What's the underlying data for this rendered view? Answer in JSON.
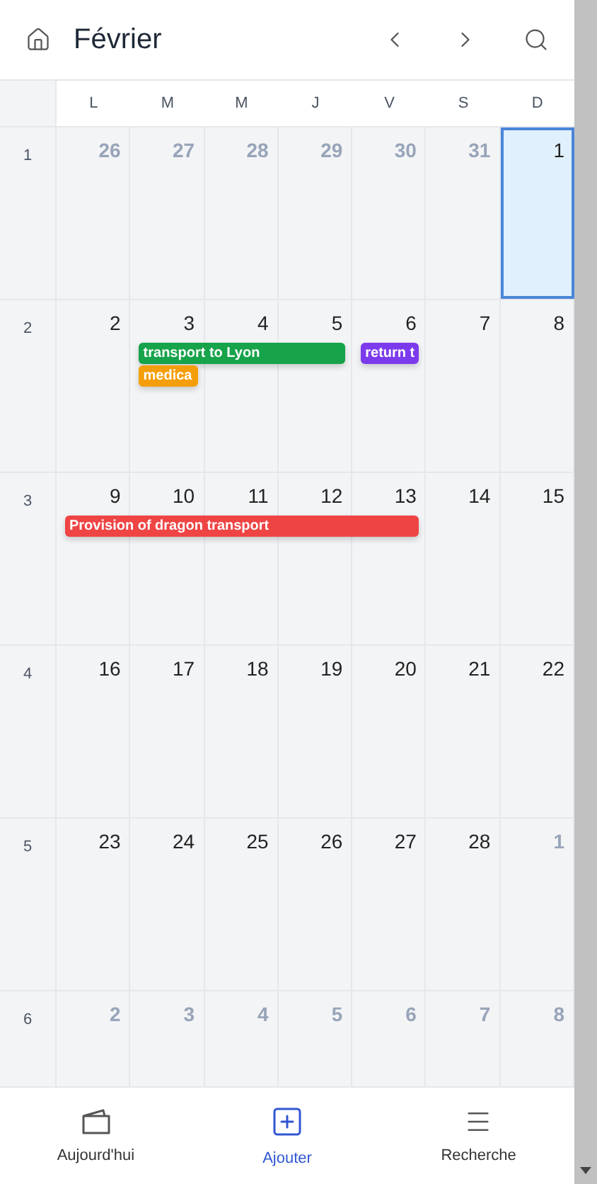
{
  "header": {
    "title": "Février"
  },
  "weekdays": [
    "L",
    "M",
    "M",
    "J",
    "V",
    "S",
    "D"
  ],
  "weeks": [
    {
      "number": "1",
      "days": [
        {
          "day": "26",
          "other_month": true,
          "today": false
        },
        {
          "day": "27",
          "other_month": true,
          "today": false
        },
        {
          "day": "28",
          "other_month": true,
          "today": false
        },
        {
          "day": "29",
          "other_month": true,
          "today": false
        },
        {
          "day": "30",
          "other_month": true,
          "today": false
        },
        {
          "day": "31",
          "other_month": true,
          "today": false
        },
        {
          "day": "1",
          "other_month": false,
          "today": true
        }
      ]
    },
    {
      "number": "2",
      "days": [
        {
          "day": "2",
          "other_month": false,
          "today": false
        },
        {
          "day": "3",
          "other_month": false,
          "today": false
        },
        {
          "day": "4",
          "other_month": false,
          "today": false
        },
        {
          "day": "5",
          "other_month": false,
          "today": false
        },
        {
          "day": "6",
          "other_month": false,
          "today": false
        },
        {
          "day": "7",
          "other_month": false,
          "today": false
        },
        {
          "day": "8",
          "other_month": false,
          "today": false
        }
      ],
      "events": [
        {
          "title": "transport to Lyon",
          "color": "#16a34a"
        },
        {
          "title": "medica",
          "color": "#f59e0b"
        },
        {
          "title": "return t",
          "color": "#7c3aed"
        }
      ]
    },
    {
      "number": "3",
      "days": [
        {
          "day": "9",
          "other_month": false,
          "today": false
        },
        {
          "day": "10",
          "other_month": false,
          "today": false
        },
        {
          "day": "11",
          "other_month": false,
          "today": false
        },
        {
          "day": "12",
          "other_month": false,
          "today": false
        },
        {
          "day": "13",
          "other_month": false,
          "today": false
        },
        {
          "day": "14",
          "other_month": false,
          "today": false
        },
        {
          "day": "15",
          "other_month": false,
          "today": false
        }
      ],
      "events": [
        {
          "title": "Provision of dragon transport",
          "color": "#ef4444"
        }
      ]
    },
    {
      "number": "4",
      "days": [
        {
          "day": "16",
          "other_month": false,
          "today": false
        },
        {
          "day": "17",
          "other_month": false,
          "today": false
        },
        {
          "day": "18",
          "other_month": false,
          "today": false
        },
        {
          "day": "19",
          "other_month": false,
          "today": false
        },
        {
          "day": "20",
          "other_month": false,
          "today": false
        },
        {
          "day": "21",
          "other_month": false,
          "today": false
        },
        {
          "day": "22",
          "other_month": false,
          "today": false
        }
      ]
    },
    {
      "number": "5",
      "days": [
        {
          "day": "23",
          "other_month": false,
          "today": false
        },
        {
          "day": "24",
          "other_month": false,
          "today": false
        },
        {
          "day": "25",
          "other_month": false,
          "today": false
        },
        {
          "day": "26",
          "other_month": false,
          "today": false
        },
        {
          "day": "27",
          "other_month": false,
          "today": false
        },
        {
          "day": "28",
          "other_month": false,
          "today": false
        },
        {
          "day": "1",
          "other_month": true,
          "today": false
        }
      ]
    },
    {
      "number": "6",
      "days": [
        {
          "day": "2",
          "other_month": true,
          "today": false
        },
        {
          "day": "3",
          "other_month": true,
          "today": false
        },
        {
          "day": "4",
          "other_month": true,
          "today": false
        },
        {
          "day": "5",
          "other_month": true,
          "today": false
        },
        {
          "day": "6",
          "other_month": true,
          "today": false
        },
        {
          "day": "7",
          "other_month": true,
          "today": false
        },
        {
          "day": "8",
          "other_month": true,
          "today": false
        }
      ]
    }
  ],
  "nav": [
    {
      "kind": "today",
      "label": "Aujourd'hui",
      "selected": false
    },
    {
      "kind": "add",
      "label": "Ajouter",
      "selected": true
    },
    {
      "kind": "search",
      "label": "Recherche",
      "selected": false
    }
  ]
}
